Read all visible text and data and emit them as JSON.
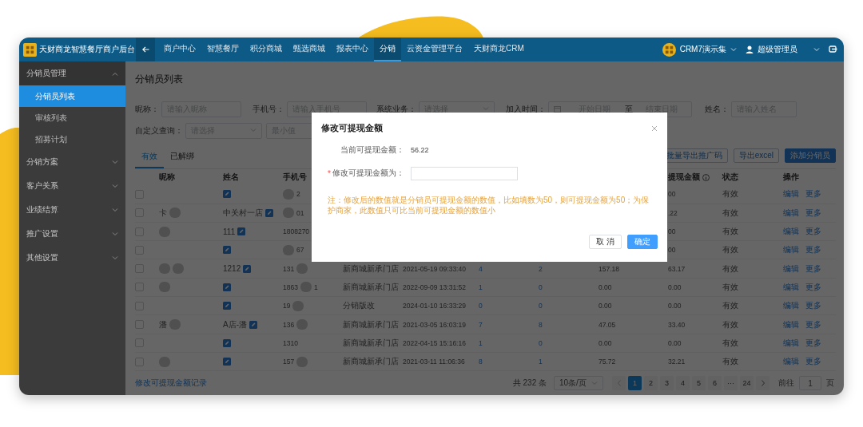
{
  "topbar": {
    "title": "天财商龙智慧餐厅商户后台",
    "tabs": [
      {
        "label": "商户中心",
        "selected": false
      },
      {
        "label": "智慧餐厅",
        "selected": false
      },
      {
        "label": "积分商城",
        "selected": false
      },
      {
        "label": "甄选商城",
        "selected": false
      },
      {
        "label": "报表中心",
        "selected": false
      },
      {
        "label": "分销",
        "selected": true
      },
      {
        "label": "云资金管理平台",
        "selected": false
      },
      {
        "label": "天财商龙CRM",
        "selected": false
      }
    ],
    "org": "CRM7演示集",
    "user": "超级管理员"
  },
  "sidebar": {
    "items": [
      {
        "label": "分销员管理",
        "expanded": true,
        "children": [
          {
            "label": "分销员列表",
            "selected": true
          },
          {
            "label": "审核列表",
            "selected": false
          },
          {
            "label": "招募计划",
            "selected": false
          }
        ]
      },
      {
        "label": "分销方案",
        "expanded": false
      },
      {
        "label": "客户关系",
        "expanded": false
      },
      {
        "label": "业绩结算",
        "expanded": false
      },
      {
        "label": "推广设置",
        "expanded": false
      },
      {
        "label": "其他设置",
        "expanded": false
      }
    ]
  },
  "page": {
    "title": "分销员列表"
  },
  "filters": [
    [
      {
        "label": "昵称：",
        "kind": "text",
        "placeholder": "请输入昵称"
      },
      {
        "label": "手机号：",
        "kind": "text",
        "placeholder": "请输入手机号"
      },
      {
        "label": "系统业务：",
        "kind": "select",
        "placeholder": "请选择"
      },
      {
        "label": "加入时间：",
        "kind": "daterange",
        "start_placeholder": "开始日期",
        "separator": "至",
        "end_placeholder": "结束日期"
      },
      {
        "label": "姓名：",
        "kind": "text",
        "placeholder": "请输入姓名"
      }
    ],
    [
      {
        "label": "自定义查询：",
        "kind": "select",
        "placeholder": "请选择"
      },
      {
        "kind": "text",
        "placeholder": "最小值"
      }
    ]
  ],
  "list_tabs": [
    {
      "label": "有效",
      "selected": true
    },
    {
      "label": "已解绑",
      "selected": false
    }
  ],
  "actions": [
    {
      "label": "批量导出推广码",
      "kind": "outline"
    },
    {
      "label": "导出excel",
      "kind": "outline"
    },
    {
      "label": "添加分销员",
      "kind": "primary"
    }
  ],
  "table": {
    "columns": {
      "nickname": "昵称",
      "name": "姓名",
      "phone": "手机号",
      "withdrawable": "提现金额",
      "status": "状态",
      "actions": "操作"
    },
    "rows": [
      {
        "checked": false,
        "nickname": [],
        "name": {
          "editable": true
        },
        "phone": [
          {
            "kind": "blur"
          },
          {
            "kind": "text",
            "text": "2"
          }
        ],
        "withdrawable": "00",
        "status": "有效",
        "actions": [
          "编辑",
          "更多"
        ]
      },
      {
        "checked": false,
        "nickname": [
          {
            "kind": "text",
            "text": "卡"
          },
          {
            "kind": "blur"
          }
        ],
        "name": {
          "text": "中关村一店",
          "editable": true
        },
        "phone": [
          {
            "kind": "blur"
          },
          {
            "kind": "text",
            "text": "01"
          }
        ],
        "withdrawable": ".22",
        "status": "有效",
        "actions": [
          "编辑",
          "更多"
        ]
      },
      {
        "checked": false,
        "nickname": [
          {
            "kind": "blur"
          }
        ],
        "name": {
          "text": "111",
          "editable": true
        },
        "phone": [
          {
            "kind": "text",
            "text": "1808270"
          }
        ],
        "withdrawable": "00",
        "status": "有效",
        "actions": [
          "编辑",
          "更多"
        ]
      },
      {
        "checked": false,
        "nickname": [],
        "name": {
          "editable": true
        },
        "phone": [
          {
            "kind": "blur"
          },
          {
            "kind": "text",
            "text": "67"
          }
        ],
        "withdrawable": "00",
        "status": "有效",
        "actions": [
          "编辑",
          "更多"
        ]
      },
      {
        "checked": false,
        "nickname": [
          {
            "kind": "blur"
          },
          {
            "kind": "blur"
          }
        ],
        "name": {
          "text": "1212",
          "editable": true
        },
        "phone": [
          {
            "kind": "text",
            "text": "131"
          },
          {
            "kind": "blur"
          }
        ],
        "column_5": "新商城新承门店",
        "column_6": "2021-05-19 09:33:40",
        "column_7": "4",
        "column_8": "2",
        "column_9": "157.18",
        "withdrawable": "63.17",
        "status": "有效",
        "actions": [
          "编辑",
          "更多"
        ]
      },
      {
        "checked": false,
        "nickname": [
          {
            "kind": "blur"
          }
        ],
        "name": {
          "editable": true
        },
        "phone": [
          {
            "kind": "text",
            "text": "1863"
          },
          {
            "kind": "blur"
          },
          {
            "kind": "text",
            "text": "1"
          }
        ],
        "column_5": "新商城新承门店",
        "column_6": "2022-09-09 13:31:52",
        "column_7": "1",
        "column_8": "0",
        "column_9": "0.00",
        "withdrawable": "0.00",
        "status": "有效",
        "actions": [
          "编辑",
          "更多"
        ]
      },
      {
        "checked": false,
        "nickname": [],
        "name": {
          "editable": true
        },
        "phone": [
          {
            "kind": "text",
            "text": "19"
          },
          {
            "kind": "blur"
          }
        ],
        "column_5": "分销版改",
        "column_6": "2024-01-10 16:33:29",
        "column_7": "0",
        "column_8": "0",
        "column_9": "0.00",
        "withdrawable": "0.00",
        "status": "有效",
        "actions": [
          "编辑",
          "更多"
        ]
      },
      {
        "checked": false,
        "nickname": [
          {
            "kind": "text",
            "text": "潘"
          },
          {
            "kind": "blur"
          }
        ],
        "name": {
          "text": "A店-潘",
          "editable": true
        },
        "phone": [
          {
            "kind": "text",
            "text": "136"
          },
          {
            "kind": "blur"
          }
        ],
        "column_5": "新商城新承门店",
        "column_6": "2021-03-05 16:03:19",
        "column_7": "7",
        "column_8": "8",
        "column_9": "47.05",
        "withdrawable": "33.40",
        "status": "有效",
        "actions": [
          "编辑",
          "更多"
        ]
      },
      {
        "checked": false,
        "nickname": [],
        "name": {
          "editable": true
        },
        "phone": [
          {
            "kind": "text",
            "text": "1310"
          }
        ],
        "column_5": "新商城新承门店",
        "column_6": "2022-04-15 15:16:16",
        "column_7": "1",
        "column_8": "0",
        "column_9": "0.00",
        "withdrawable": "0.00",
        "status": "有效",
        "actions": [
          "编辑",
          "更多"
        ]
      },
      {
        "checked": false,
        "nickname": [
          {
            "kind": "blur"
          }
        ],
        "name": {
          "editable": true
        },
        "phone": [
          {
            "kind": "text",
            "text": "157"
          },
          {
            "kind": "blur"
          }
        ],
        "column_5": "新商城新承门店",
        "column_6": "2021-03-11 11:06:36",
        "column_7": "8",
        "column_8": "1",
        "column_9": "75.72",
        "withdrawable": "32.21",
        "status": "有效",
        "actions": [
          "编辑",
          "更多"
        ]
      }
    ]
  },
  "footer": {
    "link": "修改可提现金额记录",
    "total": "共 232 条",
    "page_size": "10条/页",
    "pages": [
      {
        "label": "1",
        "selected": true
      },
      {
        "label": "2",
        "selected": false
      },
      {
        "label": "3",
        "selected": false
      },
      {
        "label": "4",
        "selected": false
      },
      {
        "label": "5",
        "selected": false
      },
      {
        "label": "6",
        "selected": false
      },
      {
        "label": "···",
        "selected": false
      },
      {
        "label": "24",
        "selected": false
      }
    ],
    "goto_label": "前往",
    "goto_value": "1",
    "goto_suffix": "页"
  },
  "dialog": {
    "title": "修改可提现金额",
    "fields": [
      {
        "kind": "static",
        "label": "当前可提现金额：",
        "value": "56.22"
      },
      {
        "kind": "input",
        "required_mark": "*",
        "label": "修改可提现金额为："
      }
    ],
    "note": "注：修改后的数值就是分销员可提现金额的数值，比如填数为50，则可提现金额为50；为保护商家，此数值只可比当前可提现金额的数值小",
    "buttons": [
      {
        "label": "取 消",
        "kind": "default"
      },
      {
        "label": "确定",
        "kind": "primary"
      }
    ]
  }
}
